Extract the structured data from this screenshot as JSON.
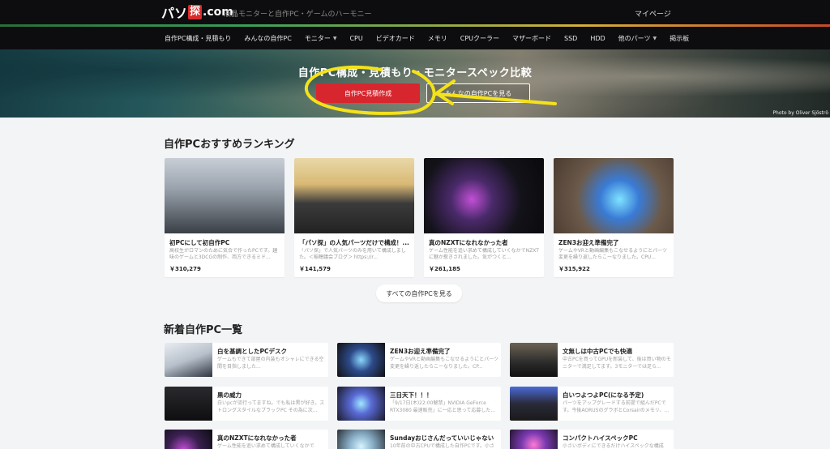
{
  "header": {
    "logo_kana": "パソ",
    "logo_tan": "探",
    "logo_domain": ".com",
    "tagline": "液晶モニターと自作PC・ゲームのハーモニー",
    "mypage": "マイページ"
  },
  "nav": {
    "items": [
      {
        "label": "自作PC構成・見積もり",
        "dropdown": false
      },
      {
        "label": "みんなの自作PC",
        "dropdown": false
      },
      {
        "label": "モニター",
        "dropdown": true
      },
      {
        "label": "CPU",
        "dropdown": false
      },
      {
        "label": "ビデオカード",
        "dropdown": false
      },
      {
        "label": "メモリ",
        "dropdown": false
      },
      {
        "label": "CPUクーラー",
        "dropdown": false
      },
      {
        "label": "マザーボード",
        "dropdown": false
      },
      {
        "label": "SSD",
        "dropdown": false
      },
      {
        "label": "HDD",
        "dropdown": false
      },
      {
        "label": "他のパーツ",
        "dropdown": true
      },
      {
        "label": "掲示板",
        "dropdown": false
      }
    ]
  },
  "hero": {
    "title": "自作PC構成・見積もり・モニタースペック比較",
    "primary_button": "自作PC見積作成",
    "secondary_button": "みんなの自作PCを見る",
    "photo_credit": "Photo by Oliver Sjöströ"
  },
  "ranking": {
    "heading": "自作PCおすすめランキング",
    "cards": [
      {
        "title": "初PCにして初自作PC",
        "desc": "高校生がロマンのために気合で作ったPCです。趣味のゲームと3DCGの制作、両方できるミド...",
        "price": "￥310,279"
      },
      {
        "title": "「パソ探」の人気パーツだけで構成！...",
        "desc": "「パソ探」で人気パーツのみを用いて構成しました。＜稲穂議会ブログ＞ https://r...",
        "price": "￥141,579"
      },
      {
        "title": "真のNZXTになれなかった者",
        "desc": "ゲーム性能を追い求めて構成していくなかでNZXTに魅か惹きされました。気がつくと...",
        "price": "￥261,185"
      },
      {
        "title": "ZEN3お迎え準備完了",
        "desc": "ゲームやVRと動画編集もこなせるようにとパーツ変更を繰り返したらこーなりました。CPU...",
        "price": "￥315,922"
      }
    ],
    "see_all": "すべての自作PCを見る"
  },
  "new_list": {
    "heading": "新着自作PC一覧",
    "items": [
      {
        "title": "白を基調としたPCデスク",
        "desc": "ゲームもできて部屋の内装もオシャレにできる空間を目指しました..."
      },
      {
        "title": "ZEN3お迎え準備完了",
        "desc": "ゲームやVRと動画編集もこなせるようにとパーツ変更を繰り返したらこーなりました。CP..."
      },
      {
        "title": "文無しは中古PCでも快適",
        "desc": "中古PCを買ってGPUを新装して、後は買い物のモニターで満足してます。3モニターでは足ら..."
      },
      {
        "title": "黒の威力",
        "desc": "白いpcが流行ってますね。でも私は黒が好き。ストロングスタイルなブラックPC その為に次..."
      },
      {
        "title": "三日天下！！！",
        "desc": "「9/17日(木)22:00解禁」NVIDIA GeForce RTX3080 最速販売」に一応と思って応募した..."
      },
      {
        "title": "白いつよつよPC(になる予定)",
        "desc": "パーツをアップグレードする前提で組んだPCです。今後AORUSのグラボとCorsairのメモリ、..."
      },
      {
        "title": "真のNZXTになれなかった者",
        "desc": "ゲーム性能を追い求めて構成していくなかで"
      },
      {
        "title": "Sundayおじさんだっていいじゃない",
        "desc": "10年前の中古CPUで構成した自作PCです。小さ"
      },
      {
        "title": "コンパクトハイスペックPC",
        "desc": "小さいボディにできるだけハイスペックな構成"
      }
    ]
  },
  "colors": {
    "accent_red": "#d8262e",
    "nav_bg": "#0d0d0f",
    "annotation_yellow": "#f4e21a"
  }
}
